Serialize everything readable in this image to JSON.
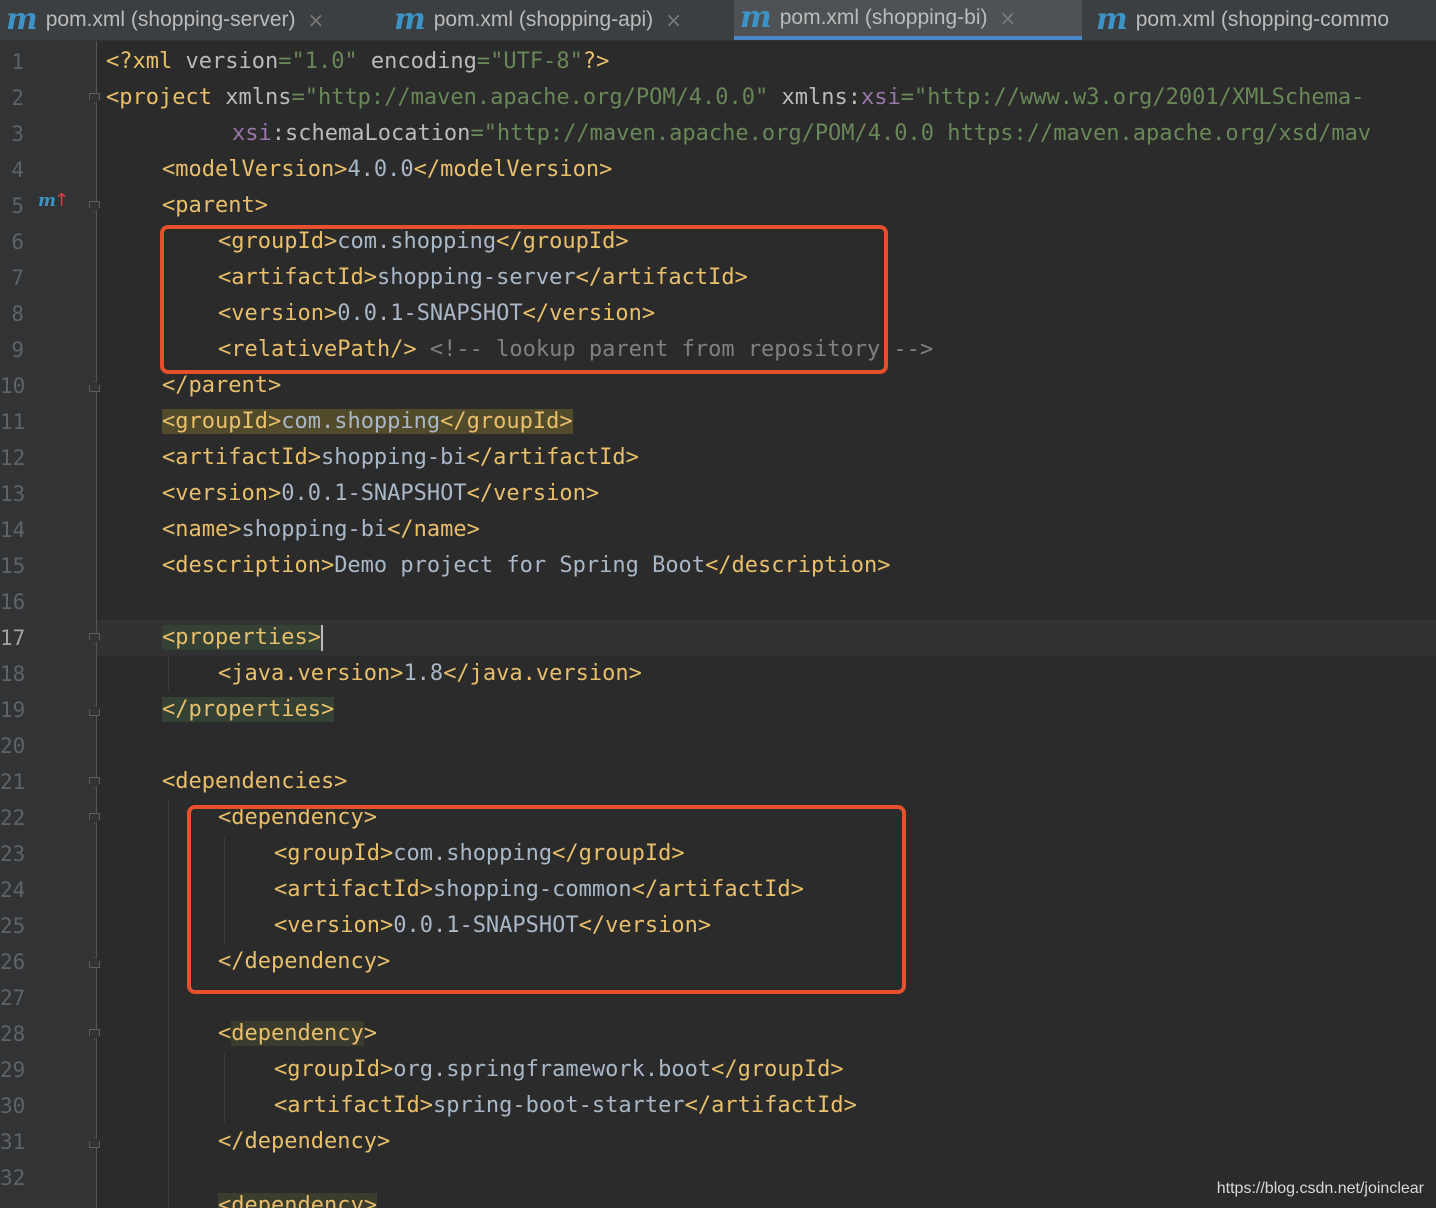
{
  "tabs": [
    {
      "icon": "maven-icon",
      "label": "pom.xml (shopping-server)",
      "close": "×",
      "active": false
    },
    {
      "icon": "maven-icon",
      "label": "pom.xml (shopping-api)",
      "close": "×",
      "active": false
    },
    {
      "icon": "maven-icon",
      "label": "pom.xml (shopping-bi)",
      "close": "×",
      "active": true
    },
    {
      "icon": "maven-icon",
      "label": "pom.xml (shopping-commo",
      "close": "",
      "active": false
    }
  ],
  "tab_icon_glyph": "m",
  "gutter": {
    "line_numbers": [
      "1",
      "2",
      "3",
      "4",
      "5",
      "6",
      "7",
      "8",
      "9",
      "10",
      "11",
      "12",
      "13",
      "14",
      "15",
      "16",
      "17",
      "18",
      "19",
      "20",
      "21",
      "22",
      "23",
      "24",
      "25",
      "26",
      "27",
      "28",
      "29",
      "30",
      "31",
      "32"
    ],
    "current_line": "17",
    "maven_marker": "m",
    "maven_marker_arrow": "↑"
  },
  "code": {
    "l1": {
      "decl_open": "<?xml ",
      "a1": "version",
      "eq1": "=",
      "v1": "\"1.0\"",
      "a2": " encoding",
      "eq2": "=",
      "v2": "\"UTF-8\"",
      "decl_close": "?>"
    },
    "l2": {
      "open": "<project ",
      "a1": "xmlns",
      "eq1": "=",
      "v1": "\"http://maven.apache.org/POM/4.0.0\"",
      "a2": " xmlns:",
      "ns": "xsi",
      "eq2": "=",
      "v2": "\"http://www.w3.org/2001/XMLSchema-"
    },
    "l3": {
      "ns": "xsi",
      "a1": ":schemaLocation",
      "eq1": "=",
      "v1": "\"http://maven.apache.org/POM/4.0.0 https://maven.apache.org/xsd/mav"
    },
    "l4": {
      "open": "<modelVersion>",
      "text": "4.0.0",
      "close": "</modelVersion>"
    },
    "l5": {
      "open": "<parent>"
    },
    "l6": {
      "open": "<groupId>",
      "text": "com.shopping",
      "close": "</groupId>"
    },
    "l7": {
      "open": "<artifactId>",
      "text": "shopping-server",
      "close": "</artifactId>"
    },
    "l8": {
      "open": "<version>",
      "text": "0.0.1-SNAPSHOT",
      "close": "</version>"
    },
    "l9": {
      "open": "<relativePath/>",
      "comment": " <!-- lookup parent from repository -->"
    },
    "l10": {
      "close": "</parent>"
    },
    "l11": {
      "open": "<groupId>",
      "text": "com.shopping",
      "close": "</groupId>"
    },
    "l12": {
      "open": "<artifactId>",
      "text": "shopping-bi",
      "close": "</artifactId>"
    },
    "l13": {
      "open": "<version>",
      "text": "0.0.1-SNAPSHOT",
      "close": "</version>"
    },
    "l14": {
      "open": "<name>",
      "text": "shopping-bi",
      "close": "</name>"
    },
    "l15": {
      "open": "<description>",
      "text": "Demo project for Spring Boot",
      "close": "</description>"
    },
    "l17": {
      "open": "<properties>"
    },
    "l18": {
      "open": "<java.version>",
      "text": "1.8",
      "close": "</java.version>"
    },
    "l19": {
      "close": "</properties>"
    },
    "l21": {
      "open": "<dependencies>"
    },
    "l22": {
      "open": "<dependency>"
    },
    "l23": {
      "open": "<groupId>",
      "text": "com.shopping",
      "close": "</groupId>"
    },
    "l24": {
      "open": "<artifactId>",
      "text": "shopping-common",
      "close": "</artifactId>"
    },
    "l25": {
      "open": "<version>",
      "text": "0.0.1-SNAPSHOT",
      "close": "</version>"
    },
    "l26": {
      "close": "</dependency>"
    },
    "l28": {
      "lt": "<",
      "name": "dependency",
      "gt": ">"
    },
    "l29": {
      "open": "<groupId>",
      "text": "org.springframework.boot",
      "close": "</groupId>"
    },
    "l30": {
      "open": "<artifactId>",
      "text": "spring-boot-starter",
      "close": "</artifactId>"
    },
    "l31": {
      "close": "</dependency>"
    },
    "l33": {
      "text": "<dependency>"
    }
  },
  "watermark": "https://blog.csdn.net/joinclear",
  "colors": {
    "editor_bg": "#2b2b2b",
    "tag": "#e8bf6a",
    "attr_value": "#6a8759",
    "namespace": "#9876aa",
    "comment": "#808080",
    "annotation_box": "#e6502c",
    "active_tab_underline": "#4a88c7",
    "maven_icon": "#3c93c6"
  }
}
